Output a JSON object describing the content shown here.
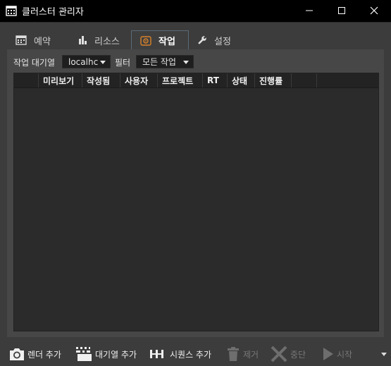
{
  "window": {
    "title": "클러스터 관리자"
  },
  "tabs": [
    {
      "label": "예약",
      "icon": "calendar-icon"
    },
    {
      "label": "리소스",
      "icon": "bar-chart-icon"
    },
    {
      "label": "작업",
      "icon": "jobs-icon",
      "active": true
    },
    {
      "label": "설정",
      "icon": "wrench-icon"
    }
  ],
  "jobs": {
    "queue_label": "작업 대기열",
    "queue_value": "localhc",
    "filter_label": "필터",
    "filter_value": "모든 작업",
    "columns": [
      "",
      "미리보기",
      "작성됨",
      "사용자",
      "프로젝트",
      "RT",
      "상태",
      "진행률",
      ""
    ],
    "rows": []
  },
  "bottom_toolbar": {
    "add_render": "렌더 추가",
    "add_queue": "대기열 추가",
    "add_sequence": "시퀀스 추가",
    "remove": "제거",
    "stop": "중단",
    "start": "시작"
  },
  "colors": {
    "accent_tab_border": "#5a6a78",
    "jobs_icon": "#d9822b"
  }
}
